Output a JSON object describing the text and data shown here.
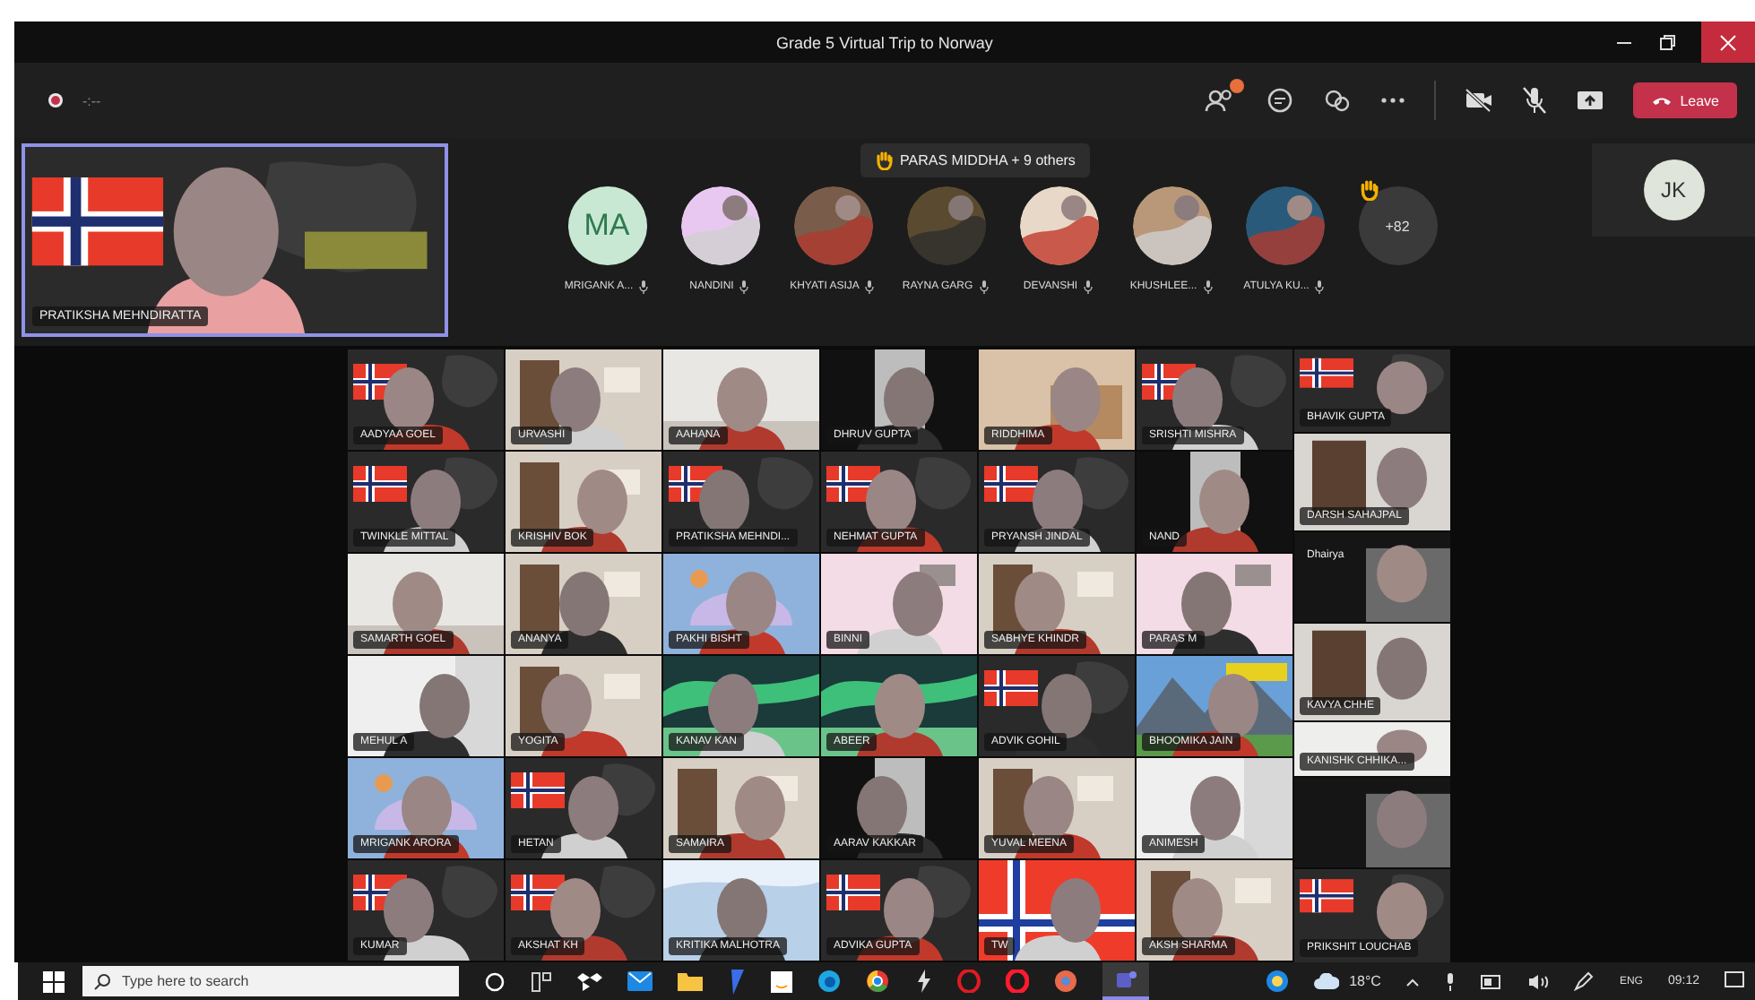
{
  "window": {
    "title": "Grade 5 Virtual Trip to Norway"
  },
  "toolbar": {
    "timer": "-:--",
    "participants_badge": true,
    "leave": "Leave"
  },
  "self_view": {
    "name": "PRATIKSHA MEHNDIRATTA"
  },
  "raised_hands": {
    "text": "PARAS MIDDHA + 9 others"
  },
  "participants": [
    {
      "name": "MRIGANK A...",
      "kind": "initials",
      "initials": "MA"
    },
    {
      "name": "NANDINI",
      "kind": "picture"
    },
    {
      "name": "KHYATI ASIJA",
      "kind": "picture"
    },
    {
      "name": "RAYNA GARG",
      "kind": "picture"
    },
    {
      "name": "DEVANSHI",
      "kind": "picture"
    },
    {
      "name": "KHUSHLEE...",
      "kind": "picture"
    },
    {
      "name": "ATULYA KU...",
      "kind": "picture"
    }
  ],
  "overflow": {
    "count": "+82",
    "hand_raised": true
  },
  "side_avatar": {
    "initials": "JK"
  },
  "grid": {
    "rows": [
      [
        {
          "name": "AADYAA GOEL"
        },
        {
          "name": "URVASHI"
        },
        {
          "name": "AAHANA"
        },
        {
          "name": "DHRUV GUPTA"
        },
        {
          "name": "RIDDHIMA"
        },
        {
          "name": "SRISHTI MISHRA"
        }
      ],
      [
        {
          "name": "TWINKLE MITTAL"
        },
        {
          "name": "KRISHIV BOK"
        },
        {
          "name": "PRATIKSHA MEHNDI..."
        },
        {
          "name": "NEHMAT GUPTA"
        },
        {
          "name": "PRYANSH JINDAL"
        },
        {
          "name": "NAND"
        }
      ],
      [
        {
          "name": "SAMARTH GOEL"
        },
        {
          "name": "ANANYA"
        },
        {
          "name": "PAKHI BISHT"
        },
        {
          "name": "BINNI"
        },
        {
          "name": "SABHYE KHINDR"
        },
        {
          "name": "PARAS M"
        }
      ],
      [
        {
          "name": "MEHUL A"
        },
        {
          "name": "YOGITA"
        },
        {
          "name": "KANAV KAN"
        },
        {
          "name": "ABEER"
        },
        {
          "name": "ADVIK GOHIL"
        },
        {
          "name": "BHOOMIKA JAIN"
        }
      ],
      [
        {
          "name": "MRIGANK ARORA"
        },
        {
          "name": "HETAN"
        },
        {
          "name": "SAMAIRA"
        },
        {
          "name": "AARAV KAKKAR"
        },
        {
          "name": "YUVAL MEENA"
        },
        {
          "name": "ANIMESH"
        }
      ],
      [
        {
          "name": "KUMAR"
        },
        {
          "name": "AKSHAT KH"
        },
        {
          "name": "KRITIKA MALHOTRA"
        },
        {
          "name": "ADVIKA GUPTA"
        },
        {
          "name": "TW"
        },
        {
          "name": "AKSH SHARMA"
        }
      ]
    ],
    "side_column": [
      {
        "kind": "video",
        "name": "BHAVIK GUPTA"
      },
      {
        "kind": "video",
        "name": "DARSH SAHAJPAL"
      },
      {
        "kind": "video",
        "name": "Dhairya"
      },
      {
        "kind": "video",
        "name": "KAVYA CHHE"
      },
      {
        "kind": "video",
        "name": "KANISHK CHHIKA..."
      },
      {
        "kind": "video"
      },
      {
        "kind": "video",
        "name": "PRIKSHIT LOUCHAB"
      }
    ]
  },
  "taskbar": {
    "search_placeholder": "Type here to search",
    "weather": "18°C",
    "language": "ENG",
    "time": "09:12"
  }
}
